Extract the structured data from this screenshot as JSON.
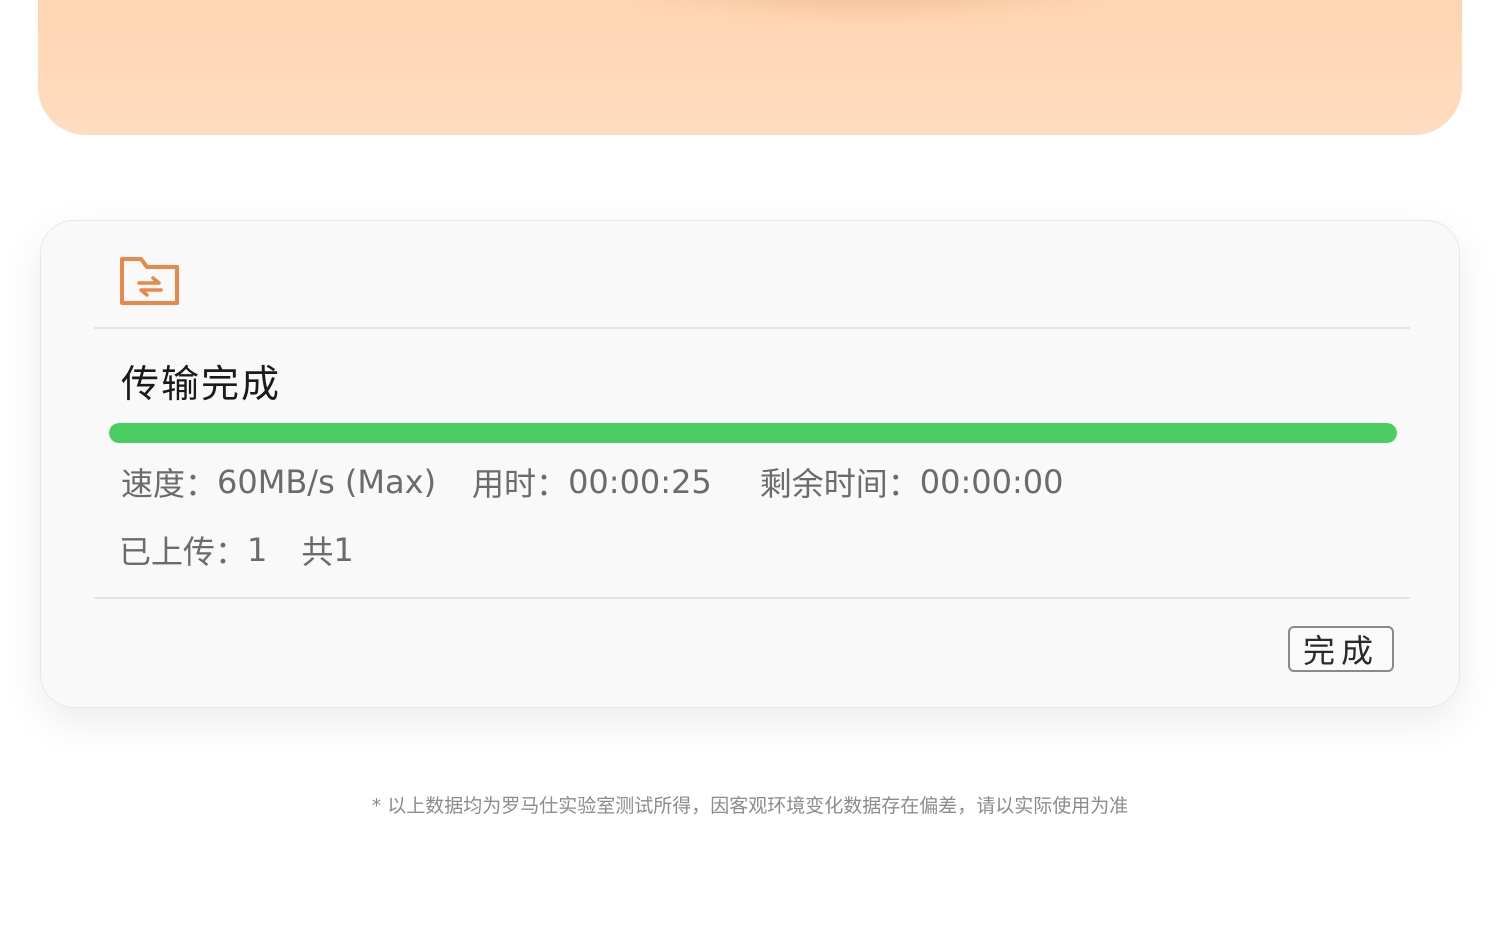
{
  "promo_card": {
    "colors": {
      "background": "#ffd6b4",
      "rim": "#f7a055",
      "device": "#eeeeee"
    }
  },
  "dialog": {
    "icon": "folder-transfer-icon",
    "title": "传输完成",
    "progress": {
      "percent": 100,
      "color": "#4ccd64"
    },
    "stats": {
      "speed_label": "速度：",
      "speed_value": "60MB/s (Max)",
      "elapsed_label": "用时：",
      "elapsed_value": "00:00:25",
      "remaining_label": "剩余时间：",
      "remaining_value": "00:00:00"
    },
    "upload": {
      "uploaded_label": "已上传：",
      "uploaded_value": "1",
      "total_label": "共",
      "total_value": "1"
    },
    "done_button_label": "完成"
  },
  "footnote": "* 以上数据均为罗马仕实验室测试所得，因客观环境变化数据存在偏差，请以实际使用为准",
  "colors": {
    "accent_orange": "#e8894a",
    "progress_green": "#4ccd64",
    "text_primary": "#1a1a1a",
    "text_secondary": "#6b6b6b"
  }
}
